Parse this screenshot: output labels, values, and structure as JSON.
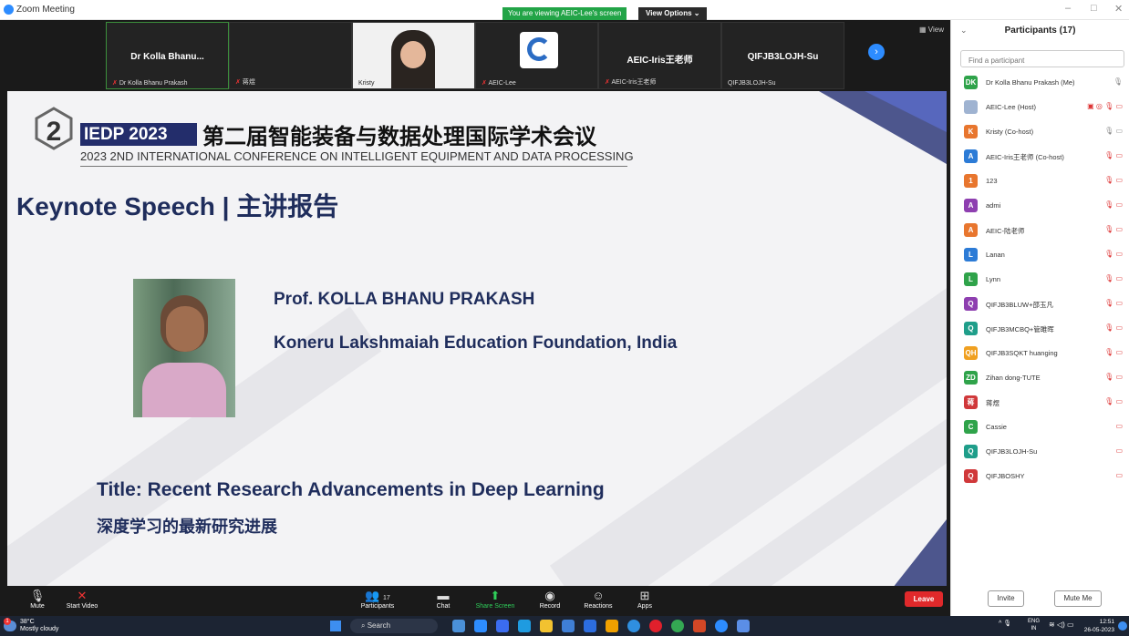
{
  "window": {
    "app_title": "Zoom Meeting",
    "viewing_banner": "You are viewing AEIC-Lee's screen",
    "view_options": "View Options ⌄",
    "view_button": "View"
  },
  "gallery": {
    "tiles": [
      {
        "name": "Dr Kolla Bhanu...",
        "label": "Dr Kolla Bhanu Prakash"
      },
      {
        "name": "",
        "label": "蒋煜"
      },
      {
        "name": "",
        "label": "Kristy"
      },
      {
        "name": "",
        "label": "AEIC-Lee"
      },
      {
        "name": "AEIC-Iris王老师",
        "label": "AEIC-Iris王老师"
      },
      {
        "name": "QIFJB3LOJH-Su",
        "label": "QIFJB3LOJH-Su"
      }
    ]
  },
  "slide": {
    "badge": "IEDP 2023",
    "conf_cn": "第二届智能装备与数据处理国际学术会议",
    "conf_en": "2023 2ND INTERNATIONAL CONFERENCE ON INTELLIGENT EQUIPMENT AND DATA PROCESSING",
    "keynote": "Keynote Speech | 主讲报告",
    "prof_name": "Prof. KOLLA BHANU PRAKASH",
    "prof_inst": "Koneru Lakshmaiah Education Foundation, India",
    "talk_title": "Title: Recent Research Advancements in Deep Learning",
    "talk_cn": "深度学习的最新研究进展"
  },
  "toolbar": {
    "mute": "Mute",
    "start_video": "Start Video",
    "participants": "Participants",
    "participants_count": "17",
    "chat": "Chat",
    "share_screen": "Share Screen",
    "record": "Record",
    "reactions": "Reactions",
    "apps": "Apps",
    "leave": "Leave"
  },
  "panel": {
    "title": "Participants (17)",
    "search_placeholder": "Find a participant",
    "participants": [
      {
        "initials": "DK",
        "color": "#2fa34a",
        "name": "Dr Kolla Bhanu Prakash (Me)",
        "icons": "🎙",
        "grey": true
      },
      {
        "initials": "",
        "color": "#9fb3d1",
        "name": "AEIC-Lee (Host)",
        "icons": "▣ ◎ 🎙 ▭",
        "grey": false
      },
      {
        "initials": "K",
        "color": "#e8762e",
        "name": "Kristy (Co-host)",
        "icons": "🎙 ▭",
        "grey": true
      },
      {
        "initials": "A",
        "color": "#2c7bd6",
        "name": "AEIC-Iris王老师 (Co-host)",
        "icons": "🎙 ▭",
        "grey": false
      },
      {
        "initials": "1",
        "color": "#e8762e",
        "name": "123",
        "icons": "🎙 ▭",
        "grey": false
      },
      {
        "initials": "A",
        "color": "#8e3fb0",
        "name": "admi",
        "icons": "🎙 ▭",
        "grey": false
      },
      {
        "initials": "A",
        "color": "#e8762e",
        "name": "AEIC-陆老师",
        "icons": "🎙 ▭",
        "grey": false
      },
      {
        "initials": "L",
        "color": "#2c7bd6",
        "name": "Lanan",
        "icons": "🎙 ▭",
        "grey": false
      },
      {
        "initials": "L",
        "color": "#2fa34a",
        "name": "Lynn",
        "icons": "🎙 ▭",
        "grey": false
      },
      {
        "initials": "Q",
        "color": "#8e3fb0",
        "name": "QIFJB3BLUW+邵玉凡",
        "icons": "🎙 ▭",
        "grey": false
      },
      {
        "initials": "Q",
        "color": "#1f9e8a",
        "name": "QIFJB3MCBQ+管雎晖",
        "icons": "🎙 ▭",
        "grey": false
      },
      {
        "initials": "QH",
        "color": "#f0a020",
        "name": "QIFJB3SQKT huanging",
        "icons": "🎙 ▭",
        "grey": false
      },
      {
        "initials": "ZD",
        "color": "#2fa34a",
        "name": "Zihan dong-TUTE",
        "icons": "🎙 ▭",
        "grey": false
      },
      {
        "initials": "蒋",
        "color": "#d0383a",
        "name": "蒋煜",
        "icons": "🎙 ▭",
        "grey": false
      },
      {
        "initials": "C",
        "color": "#2fa34a",
        "name": "Cassie",
        "icons": "▭",
        "grey": false
      },
      {
        "initials": "Q",
        "color": "#1f9e8a",
        "name": "QIFJB3LOJH-Su",
        "icons": "▭",
        "grey": false
      },
      {
        "initials": "Q",
        "color": "#d0383a",
        "name": "QIFJBOSHY",
        "icons": "▭",
        "grey": false
      }
    ],
    "invite": "Invite",
    "mute_me": "Mute Me"
  },
  "taskbar": {
    "temp": "38°C",
    "weather": "Mostly cloudy",
    "weather_badge": "1",
    "search": "Search",
    "lang_top": "ENG",
    "lang_bottom": "IN",
    "time": "12:51",
    "date": "26-05-2023"
  }
}
